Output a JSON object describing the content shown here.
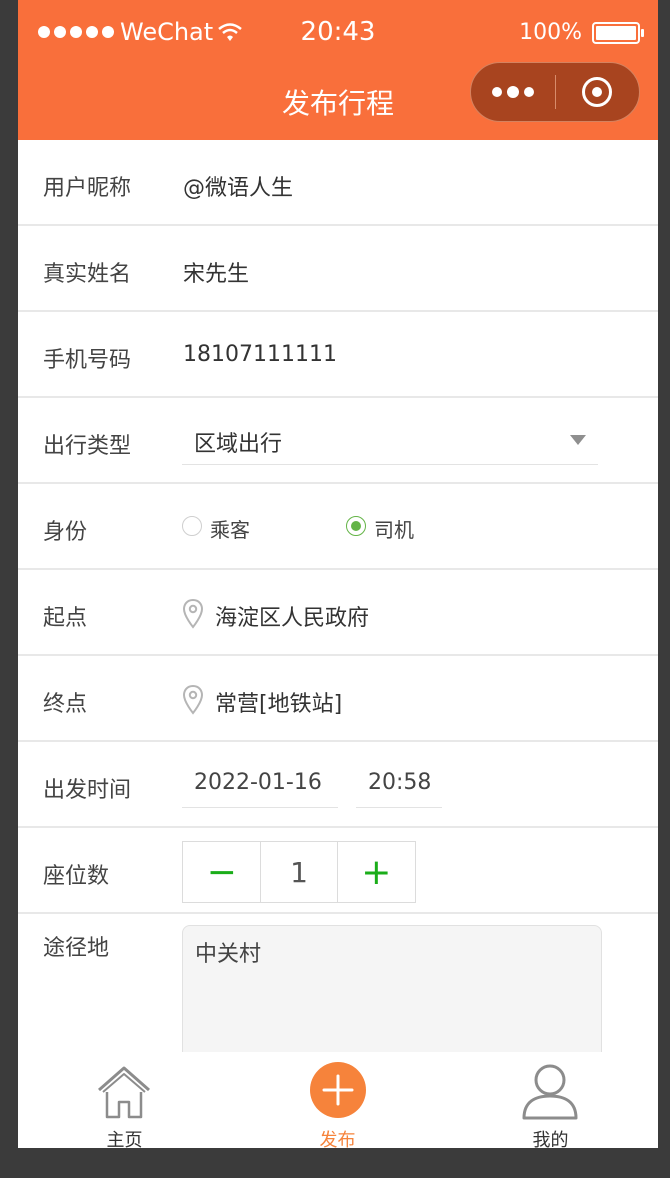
{
  "status_bar": {
    "carrier": "WeChat",
    "time": "20:43",
    "battery": "100%"
  },
  "nav": {
    "title": "发布行程"
  },
  "form": {
    "nickname": {
      "label": "用户昵称",
      "value": "@微语人生"
    },
    "real_name": {
      "label": "真实姓名",
      "value": "宋先生"
    },
    "phone": {
      "label": "手机号码",
      "value": "18107111111"
    },
    "trip_type": {
      "label": "出行类型",
      "value": "区域出行"
    },
    "identity": {
      "label": "身份",
      "options": [
        "乘客",
        "司机"
      ],
      "selected": "司机"
    },
    "start": {
      "label": "起点",
      "value": "海淀区人民政府"
    },
    "end": {
      "label": "终点",
      "value": "常营[地铁站]"
    },
    "depart": {
      "label": "出发时间",
      "date": "2022-01-16",
      "time": "20:58"
    },
    "seats": {
      "label": "座位数",
      "minus": "−",
      "value": "1",
      "plus": "+"
    },
    "via": {
      "label": "途径地",
      "value": "中关村"
    }
  },
  "tabbar": {
    "items": [
      {
        "label": "主页"
      },
      {
        "label": "发布"
      },
      {
        "label": "我的"
      }
    ],
    "active": "发布"
  },
  "colors": {
    "brand": "#f96f3b",
    "accent": "#f6833b",
    "green": "#1aad19"
  }
}
